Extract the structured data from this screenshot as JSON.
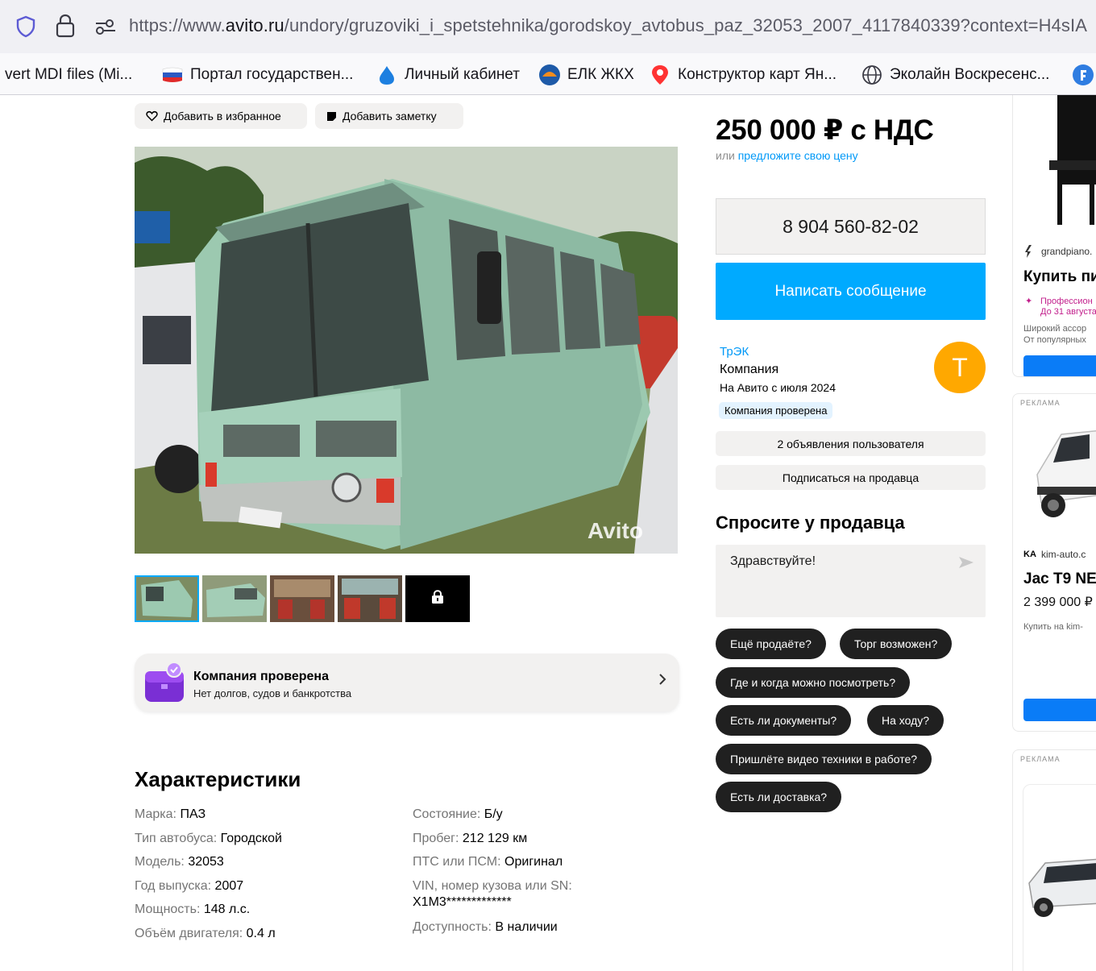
{
  "browser": {
    "url_prefix": "https://www.",
    "url_host": "avito.ru",
    "url_path": "/undory/gruzoviki_i_spetstehnika/gorodskoy_avtobus_paz_32053_2007_4117840339?context=H4sIA",
    "bookmarks": [
      {
        "label": "vert MDI files (Mi...",
        "icon": "none"
      },
      {
        "label": "Портал государствен...",
        "icon": "russia-flag-icon"
      },
      {
        "label": "Личный кабинет",
        "icon": "drop-icon"
      },
      {
        "label": "ЕЛК ЖКХ",
        "icon": "elk-logo-icon"
      },
      {
        "label": "Конструктор карт Ян...",
        "icon": "map-pin-icon"
      },
      {
        "label": "Эколайн Воскресенс...",
        "icon": "globe-icon"
      }
    ]
  },
  "listing": {
    "favorite_label": "Добавить в избранное",
    "note_label": "Добавить заметку",
    "watermark": "Avito",
    "verified": {
      "title": "Компания проверена",
      "subtitle": "Нет долгов, судов и банкротства"
    },
    "specs_title": "Характеристики",
    "specs_left": [
      {
        "k": "Марка: ",
        "v": "ПАЗ"
      },
      {
        "k": "Тип автобуса: ",
        "v": "Городской"
      },
      {
        "k": "Модель: ",
        "v": "32053"
      },
      {
        "k": "Год выпуска: ",
        "v": "2007"
      },
      {
        "k": "Мощность: ",
        "v": "148 л.с."
      },
      {
        "k": "Объём двигателя: ",
        "v": "0.4 л"
      }
    ],
    "specs_right": [
      {
        "k": "Состояние: ",
        "v": "Б/у"
      },
      {
        "k": "Пробег: ",
        "v": "212 129 км"
      },
      {
        "k": "ПТС или ПСМ: ",
        "v": "Оригинал"
      },
      {
        "k": "VIN, номер кузова или SN:",
        "v": "X1M3*************"
      },
      {
        "k": "Доступность: ",
        "v": "В наличии"
      }
    ]
  },
  "sidebar": {
    "price": "250 000 ₽ с НДС",
    "offer_prefix": "или ",
    "offer_link": "предложите свою цену",
    "phone": "8 904 560-82-02",
    "message_button": "Написать сообщение",
    "seller_name": "ТрЭК",
    "seller_type": "Компания",
    "seller_since": "На Авито с июля 2024",
    "seller_badge": "Компания проверена",
    "avatar_letter": "Т",
    "avatar_color": "#ffa800",
    "listings_button": "2 объявления пользователя",
    "subscribe_button": "Подписаться на продавца",
    "ask_title": "Спросите у продавца",
    "ask_placeholder": "Здравствуйте!",
    "chips": [
      "Ещё продаёте?",
      "Торг возможен?",
      "Где и когда можно посмотреть?",
      "Есть ли документы?",
      "На ходу?",
      "Пришлёте видео техники в работе?",
      "Есть ли доставка?"
    ],
    "accent_color": "#00aaff"
  },
  "ads": {
    "ad1_source": "grandpiano.",
    "ad1_title": "Купить пи",
    "ad1_promo1": "Профессион",
    "ad1_promo2": "До 31 августа",
    "ad1_line1": "Широкий ассор",
    "ad1_line2": "От популярных",
    "ad2_label": "РЕКЛАМА",
    "ad2_source": "kim-auto.c",
    "ad2_title": "Jac T9 NE",
    "ad2_price": "2 399 000 ₽",
    "ad2_line": "Купить на kim-",
    "ad3_label": "РЕКЛАМА"
  }
}
